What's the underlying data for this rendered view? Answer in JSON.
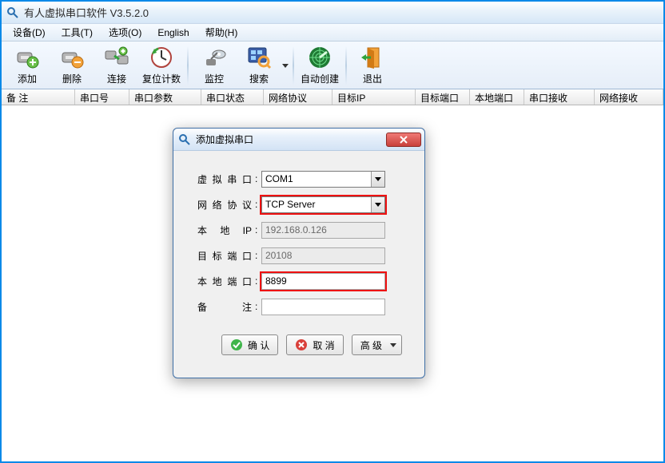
{
  "app": {
    "title": "有人虚拟串口软件 V3.5.2.0"
  },
  "menu": {
    "device": "设备(D)",
    "tools": "工具(T)",
    "options": "选项(O)",
    "english": "English",
    "help": "帮助(H)"
  },
  "toolbar": {
    "add": "添加",
    "delete": "删除",
    "connect": "连接",
    "reset": "复位计数",
    "monitor": "监控",
    "search": "搜索",
    "autocreate": "自动创建",
    "exit": "退出"
  },
  "columns": {
    "remark": "备 注",
    "com_no": "串口号",
    "com_params": "串口参数",
    "com_state": "串口状态",
    "net_proto": "网络协议",
    "target_ip": "目标IP",
    "target_port": "目标端口",
    "local_port": "本地端口",
    "com_recv": "串口接收",
    "net_recv": "网络接收"
  },
  "dialog": {
    "title": "添加虚拟串口",
    "labels": {
      "vcom": "虚拟串口",
      "net_proto": "网络协议",
      "local_ip": "本地IP",
      "target_port": "目标端口",
      "local_port": "本地端口",
      "remark": "备　注"
    },
    "values": {
      "vcom": "COM1",
      "net_proto": "TCP Server",
      "local_ip": "192.168.0.126",
      "target_port": "20108",
      "local_port": "8899",
      "remark": ""
    },
    "buttons": {
      "ok": "确  认",
      "cancel": "取  消",
      "advanced": "高 级"
    }
  }
}
